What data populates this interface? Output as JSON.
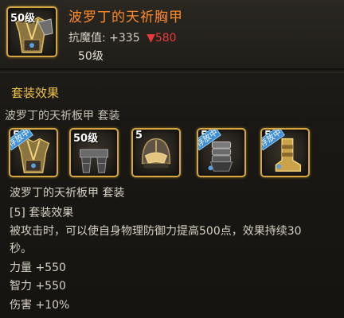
{
  "item": {
    "level_badge": "50级",
    "name": "波罗丁的天祈胸甲",
    "stat_label": "抗魔值:",
    "stat_value": "+335",
    "stat_diff": "▼580",
    "level_text": "50级"
  },
  "set": {
    "section_title": "套装效果",
    "header_line": "波罗丁的天祈板甲  套装",
    "slots": [
      {
        "icon": "chest-armor-icon",
        "tag": "存放中",
        "corner": "5"
      },
      {
        "icon": "leg-armor-icon",
        "tag": "",
        "corner": "50级"
      },
      {
        "icon": "helmet-icon",
        "tag": "",
        "corner": "5"
      },
      {
        "icon": "gauntlet-icon",
        "tag": "存放中",
        "corner": "5"
      },
      {
        "icon": "boots-icon",
        "tag": "存放中",
        "corner": "5"
      }
    ],
    "desc_name": "波罗丁的天祈板甲  套装",
    "bonus_count": "[5] 套装效果",
    "effect_line1": "被攻击时，可以使自身物理防御力提高500点，效果持续30",
    "effect_line2": "秒。",
    "bonus_str": "力量 +550",
    "bonus_int": "智力 +550",
    "bonus_dmg": "伤害 +10%"
  },
  "colors": {
    "name_orange": "#ff8a2a",
    "gold_title": "#f0c24a",
    "down_red": "#e83a3a",
    "slot_border": "#d6a640",
    "tag_blue": "#3f90d6"
  }
}
